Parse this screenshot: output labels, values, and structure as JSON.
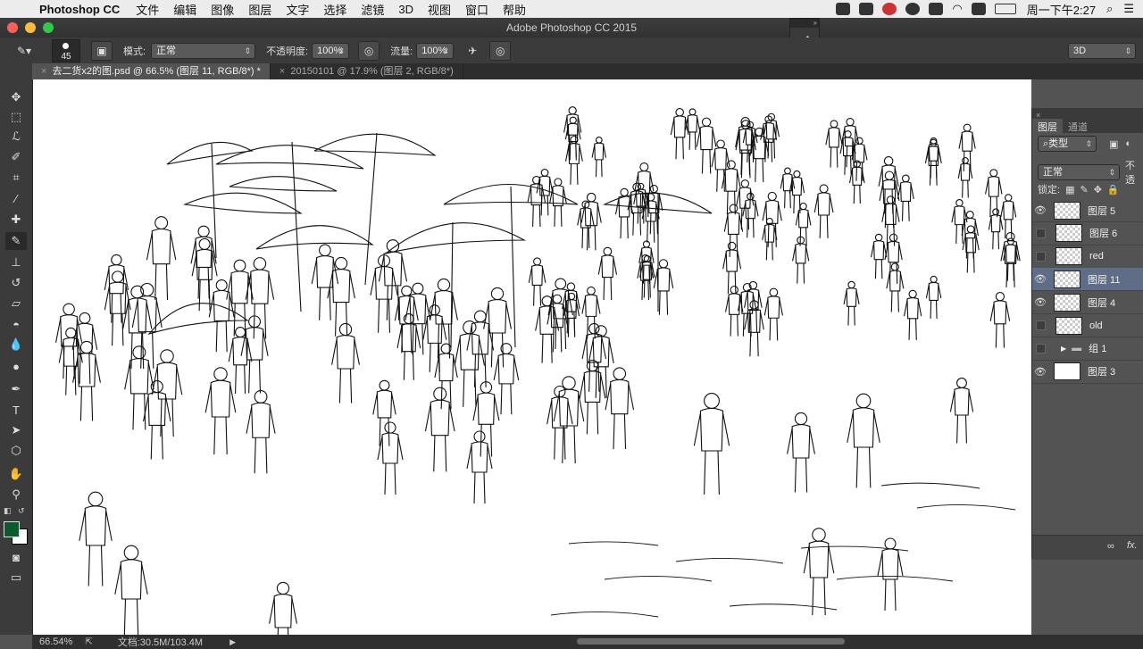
{
  "menubar": {
    "app_name": "Photoshop CC",
    "items": [
      "文件",
      "编辑",
      "图像",
      "图层",
      "文字",
      "选择",
      "滤镜",
      "3D",
      "视图",
      "窗口",
      "帮助"
    ],
    "clock": "周一下午2:27"
  },
  "window": {
    "title": "Adobe Photoshop CC 2015"
  },
  "options": {
    "brush_size": "45",
    "mode_label": "模式:",
    "mode_value": "正常",
    "opacity_label": "不透明度:",
    "opacity_value": "100%",
    "flow_label": "流量:",
    "flow_value": "100%",
    "workspace_value": "3D"
  },
  "tabs": [
    {
      "label": "去二货x2的图.psd @ 66.5% (图层 11, RGB/8*) *",
      "active": true
    },
    {
      "label": "20150101 @ 17.9% (图层 2, RGB/8*)",
      "active": false
    }
  ],
  "tools": [
    "move-icon",
    "marquee-icon",
    "lasso-icon",
    "quick-select-icon",
    "crop-icon",
    "eyedropper-icon",
    "healing-icon",
    "brush-icon",
    "stamp-icon",
    "history-brush-icon",
    "eraser-icon",
    "paint-bucket-icon",
    "dodge-icon",
    "pen-icon",
    "type-icon",
    "path-select-icon",
    "shape-icon",
    "hand-icon",
    "zoom-icon"
  ],
  "colors": {
    "foreground": "#0b5a2c",
    "background": "#ffffff",
    "selected_layer": "#5f6e86"
  },
  "layers_panel": {
    "tab_layers": "图层",
    "tab_channels": "通道",
    "filter_label": "类型",
    "blend_mode": "正常",
    "opacity_label_short": "不透",
    "lock_label": "锁定:",
    "fx_label": "fx.",
    "layers": [
      {
        "name": "图层 5",
        "visible": true,
        "selected": false,
        "type": "layer"
      },
      {
        "name": "图层 6",
        "visible": false,
        "selected": false,
        "type": "layer"
      },
      {
        "name": "red",
        "visible": false,
        "selected": false,
        "type": "layer"
      },
      {
        "name": "图层 11",
        "visible": true,
        "selected": true,
        "type": "layer"
      },
      {
        "name": "图层 4",
        "visible": true,
        "selected": false,
        "type": "layer"
      },
      {
        "name": "old",
        "visible": false,
        "selected": false,
        "type": "layer"
      },
      {
        "name": "组 1",
        "visible": false,
        "selected": false,
        "type": "group"
      },
      {
        "name": "图层 3",
        "visible": true,
        "selected": false,
        "type": "background"
      }
    ]
  },
  "status": {
    "zoom": "66.54%",
    "doc_info": "文档:30.5M/103.4M"
  }
}
